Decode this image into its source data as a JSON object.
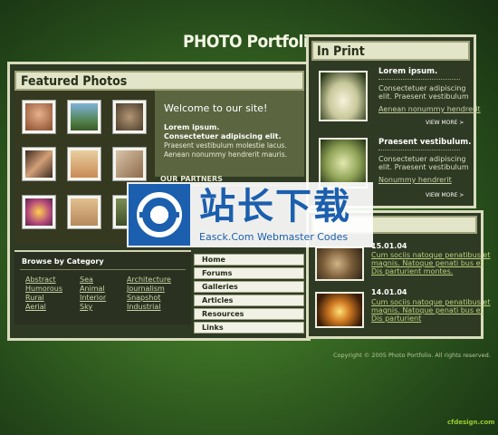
{
  "site_title": "PHOTO Portfolio",
  "featured": {
    "title": "Featured Photos",
    "thumb_colors": [
      "#c98a5e",
      "#5b8fb6",
      "#7d6f52",
      "#b9875f",
      "#d7b07a",
      "#8e7458",
      "#a44c78",
      "#c8a070",
      "#6a7f4c"
    ]
  },
  "welcome": {
    "title": "Welcome to our site!",
    "lead1": "Lorem ipsum.",
    "lead2": "Consectetuer adipiscing elit.",
    "body1": "Praesent vestibulum molestie lacus.",
    "body2": "Aenean nonummy hendrerit mauris.",
    "partners_title": "OUR PARTNERS"
  },
  "browse": {
    "title": "Browse by Category",
    "col1": [
      "Abstract",
      "Humorous",
      "Rural",
      "Aerial"
    ],
    "col2": [
      "Sea",
      "Animal",
      "Interior",
      "Sky"
    ],
    "col3": [
      "Architecture",
      "Journalism",
      "Snapshot",
      "Industrial"
    ]
  },
  "menu": [
    "Home",
    "Forums",
    "Galleries",
    "Articles",
    "Resources",
    "Links"
  ],
  "print": {
    "title": "In Print",
    "items": [
      {
        "heading": "Lorem ipsum.",
        "line1": "Consectetuer adipiscing",
        "line2": "elit. Praesent vestibulum",
        "link": "Aenean nonummy hendrerit",
        "more": "VIEW MORE >"
      },
      {
        "heading": "Praesent vestibulum.",
        "line1": "Consectetuer adipiscing",
        "line2": "elit. Praesent vestibulum",
        "link": "Nonummy hendrerit",
        "more": "VIEW MORE >"
      }
    ]
  },
  "news": [
    {
      "date": "15.01.04",
      "l1": "Cum sociis natoque penatibus et",
      "l2": "magnis. Natoque penati bus et",
      "l3": "Dis parturient montes."
    },
    {
      "date": "14.01.04",
      "l1": "Cum sociis natoque penatibus et",
      "l2": "magnis. Natoque penati bus et",
      "l3": "Dis parturient"
    }
  ],
  "copyright": "Copyright © 2005 Photo Portfolio. All rights reserved.",
  "watermark": {
    "cn": "站长下载",
    "en": "Easck.Com Webmaster Codes"
  },
  "corner_logo": "cfdesign.com"
}
